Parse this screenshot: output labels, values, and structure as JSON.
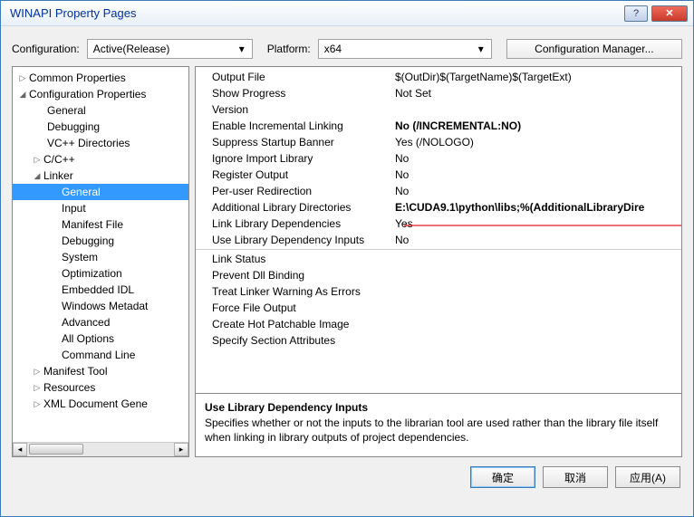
{
  "title": "WINAPI Property Pages",
  "config_label": "Configuration:",
  "config_value": "Active(Release)",
  "platform_label": "Platform:",
  "platform_value": "x64",
  "config_mgr_btn": "Configuration Manager...",
  "tree": {
    "common": "Common Properties",
    "cfgprops": "Configuration Properties",
    "general": "General",
    "debugging": "Debugging",
    "vcdirs": "VC++ Directories",
    "cc": "C/C++",
    "linker": "Linker",
    "linker_general": "General",
    "linker_input": "Input",
    "linker_manifest": "Manifest File",
    "linker_debugging": "Debugging",
    "linker_system": "System",
    "linker_opt": "Optimization",
    "linker_embedded": "Embedded IDL",
    "linker_winmeta": "Windows Metadat",
    "linker_advanced": "Advanced",
    "linker_alloptions": "All Options",
    "linker_cmdline": "Command Line",
    "manifest_tool": "Manifest Tool",
    "resources": "Resources",
    "xml": "XML Document Gene"
  },
  "props": [
    {
      "name": "Output File",
      "value": "$(OutDir)$(TargetName)$(TargetExt)"
    },
    {
      "name": "Show Progress",
      "value": "Not Set"
    },
    {
      "name": "Version",
      "value": ""
    },
    {
      "name": "Enable Incremental Linking",
      "value": "No (/INCREMENTAL:NO)",
      "bold": true
    },
    {
      "name": "Suppress Startup Banner",
      "value": "Yes (/NOLOGO)"
    },
    {
      "name": "Ignore Import Library",
      "value": "No"
    },
    {
      "name": "Register Output",
      "value": "No"
    },
    {
      "name": "Per-user Redirection",
      "value": "No"
    },
    {
      "name": "Additional Library Directories",
      "value": "E:\\CUDA9.1\\python\\libs;%(AdditionalLibraryDire",
      "bold": true
    },
    {
      "name": "Link Library Dependencies",
      "value": "Yes"
    },
    {
      "name": "Use Library Dependency Inputs",
      "value": "No"
    },
    {
      "name": "Link Status",
      "value": ""
    },
    {
      "name": "Prevent Dll Binding",
      "value": ""
    },
    {
      "name": "Treat Linker Warning As Errors",
      "value": ""
    },
    {
      "name": "Force File Output",
      "value": ""
    },
    {
      "name": "Create Hot Patchable Image",
      "value": ""
    },
    {
      "name": "Specify Section Attributes",
      "value": ""
    }
  ],
  "desc": {
    "title": "Use Library Dependency Inputs",
    "text": "Specifies whether or not the inputs to the librarian tool are used rather than the library file itself when linking in library outputs of project dependencies."
  },
  "buttons": {
    "ok": "确定",
    "cancel": "取消",
    "apply": "应用(A)"
  }
}
